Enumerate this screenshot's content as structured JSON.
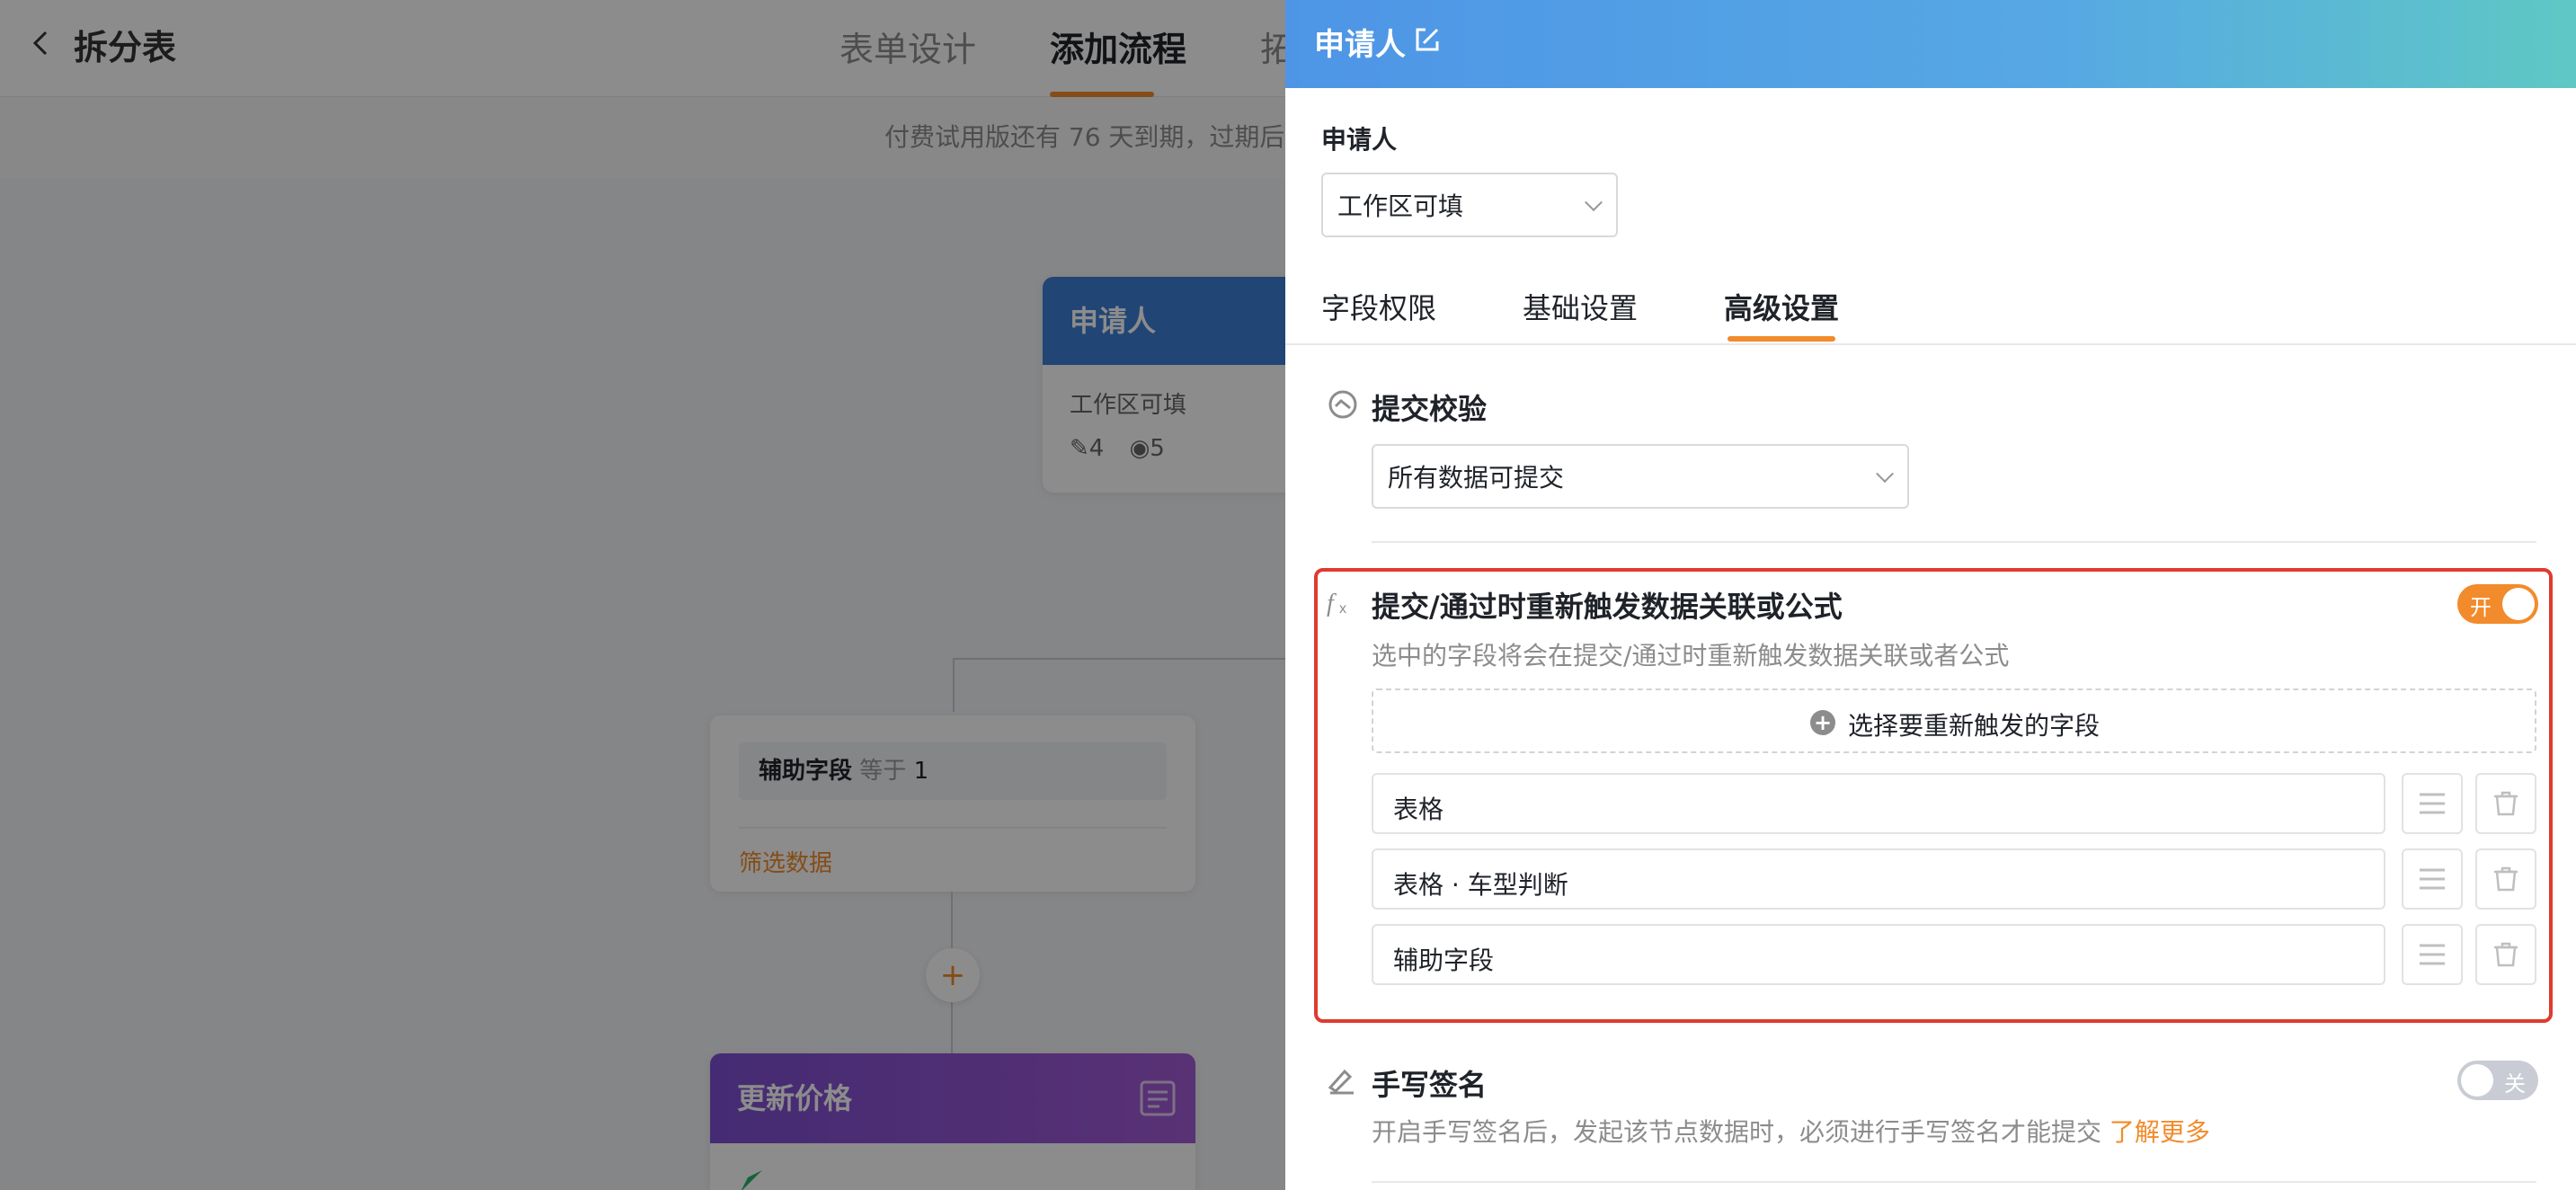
{
  "app": {
    "back_label": "‹",
    "title": "拆分表"
  },
  "nav_tabs": [
    {
      "label": "表单设计"
    },
    {
      "label": "添加流程"
    },
    {
      "label": "拓"
    }
  ],
  "notice": "付费试用版还有 76 天到期，过期后",
  "canvas": {
    "applicant_card": {
      "title": "申请人",
      "subtitle": "工作区可填",
      "edit_count": "4",
      "view_count": "5"
    },
    "filter_card": {
      "field": "辅助字段",
      "op": "等于",
      "value": "1",
      "footer": "筛选数据"
    },
    "update_card": {
      "title": "更新价格"
    },
    "add_node": "+"
  },
  "panel": {
    "header_title": "申请人",
    "applicant_label": "申请人",
    "applicant_select": "工作区可填",
    "tabs": [
      {
        "label": "字段权限"
      },
      {
        "label": "基础设置"
      },
      {
        "label": "高级设置"
      }
    ],
    "submit_check": {
      "title": "提交校验",
      "select": "所有数据可提交"
    },
    "retrigger": {
      "title": "提交/通过时重新触发数据关联或公式",
      "toggle_label": "开",
      "desc": "选中的字段将会在提交/通过时重新触发数据关联或者公式",
      "add_label": "选择要重新触发的字段",
      "fields": [
        {
          "name": "表格"
        },
        {
          "name": "表格 · 车型判断"
        },
        {
          "name": "辅助字段"
        }
      ]
    },
    "signature": {
      "title": "手写签名",
      "toggle_label": "关",
      "desc": "开启手写签名后，发起该节点数据时，必须进行手写签名才能提交",
      "link": "了解更多"
    }
  },
  "colors": {
    "accent": "#f28b2b",
    "header_start": "#4e95e6",
    "header_end": "#5fc8c4",
    "highlight_border": "#e03a2f",
    "applicant_card": "#3d7ed6",
    "update_card_start": "#7d4fd1",
    "update_card_end": "#a35ad6"
  }
}
